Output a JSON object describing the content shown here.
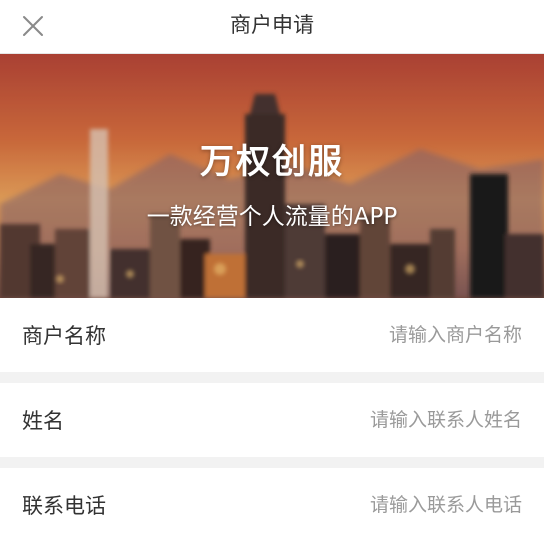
{
  "header": {
    "title": "商户申请"
  },
  "banner": {
    "title": "万权创服",
    "subtitle": "一款经营个人流量的APP"
  },
  "form": {
    "fields": [
      {
        "label": "商户名称",
        "placeholder": "请输入商户名称",
        "value": ""
      },
      {
        "label": "姓名",
        "placeholder": "请输入联系人姓名",
        "value": ""
      },
      {
        "label": "联系电话",
        "placeholder": "请输入联系人电话",
        "value": ""
      }
    ]
  },
  "icons": {
    "close": "close-icon"
  },
  "colors": {
    "header_bg": "#ffffff",
    "page_bg": "#f2f2f2",
    "label_text": "#333333",
    "placeholder_text": "#9a9a9a",
    "banner_sky_top": "#c0473a",
    "banner_sky_mid": "#e48a4c",
    "banner_sky_low": "#f2c27a"
  }
}
